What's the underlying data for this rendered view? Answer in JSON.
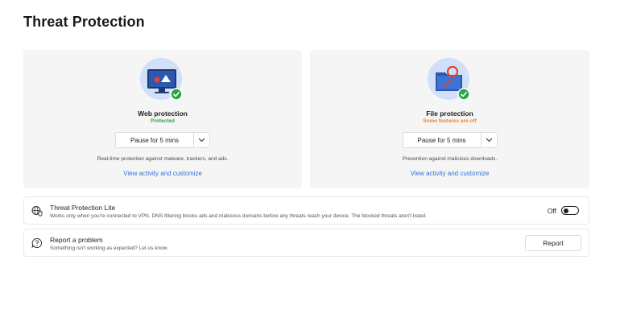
{
  "page": {
    "title": "Threat Protection"
  },
  "cards": {
    "web": {
      "icon": "monitor-shield-icon",
      "title": "Web protection",
      "status": "Protected",
      "status_color": "#27a847",
      "pause_label": "Pause for 5 mins",
      "description": "Real-time protection against malware, trackers, and ads.",
      "link": "View activity and customize"
    },
    "file": {
      "icon": "folder-shield-icon",
      "title": "File protection",
      "status": "Some features are off",
      "status_color": "#f0822e",
      "pause_label": "Pause for 5 mins",
      "description": "Prevention against malicious downloads.",
      "link": "View activity and customize"
    }
  },
  "lite": {
    "icon": "globe-shield-icon",
    "title": "Threat Protection Lite",
    "subtitle": "Works only when you're connected to VPN. DNS filtering blocks ads and malicious domains before any threats reach your device. The blocked threats aren't listed.",
    "toggle_label": "Off",
    "toggle_on": false
  },
  "report": {
    "icon": "question-bubble-icon",
    "title": "Report a problem",
    "subtitle": "Something isn't working as expected? Let us know.",
    "button_label": "Report"
  },
  "colors": {
    "accent": "#2f72d8",
    "ok": "#27a847",
    "warn": "#f0822e"
  }
}
